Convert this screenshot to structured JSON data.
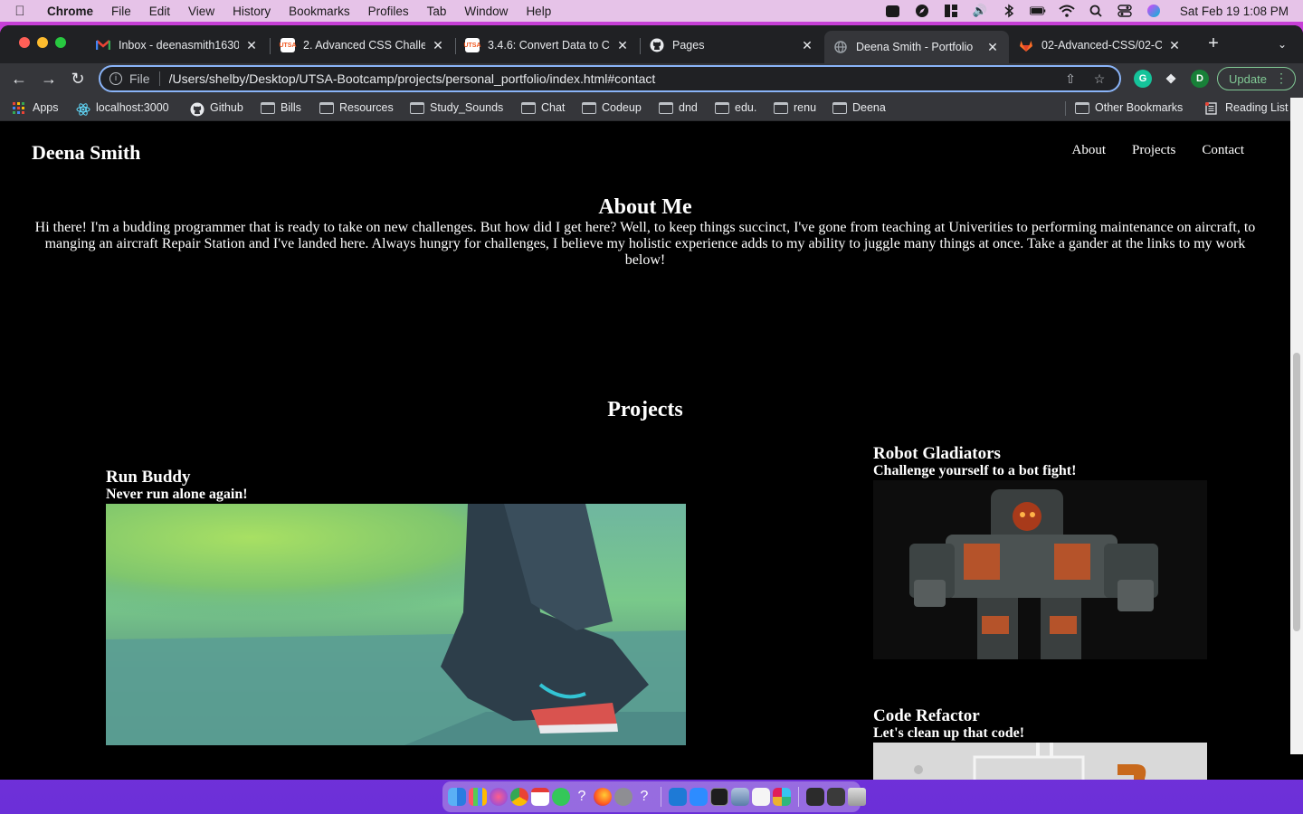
{
  "menubar": {
    "app_name": "Chrome",
    "items": [
      "File",
      "Edit",
      "View",
      "History",
      "Bookmarks",
      "Profiles",
      "Tab",
      "Window",
      "Help"
    ],
    "clock": "Sat Feb 19  1:08 PM"
  },
  "tabs": [
    {
      "title": "Inbox - deenasmith1630",
      "icon": "gmail-icon",
      "active": false
    },
    {
      "title": "2. Advanced CSS Challe",
      "icon": "utsa-icon",
      "active": false
    },
    {
      "title": "3.4.6: Convert Data to C",
      "icon": "utsa-icon",
      "active": false
    },
    {
      "title": "Pages",
      "icon": "github-icon",
      "active": false
    },
    {
      "title": "Deena Smith - Portfolio",
      "icon": "globe-icon",
      "active": true
    },
    {
      "title": "02-Advanced-CSS/02-C",
      "icon": "gitlab-icon",
      "active": false
    }
  ],
  "omnibox": {
    "scheme": "File",
    "url": "/Users/shelby/Desktop/UTSA-Bootcamp/projects/personal_portfolio/index.html#contact"
  },
  "toolbar": {
    "profile_initial": "D",
    "update_label": "Update"
  },
  "bookmarks": {
    "items": [
      {
        "label": "Apps",
        "icon": "apps-grid-icon"
      },
      {
        "label": "localhost:3000",
        "icon": "react-icon"
      },
      {
        "label": "Github",
        "icon": "github-icon"
      },
      {
        "label": "Bills",
        "icon": "folder-icon"
      },
      {
        "label": "Resources",
        "icon": "folder-icon"
      },
      {
        "label": "Study_Sounds",
        "icon": "folder-icon"
      },
      {
        "label": "Chat",
        "icon": "folder-icon"
      },
      {
        "label": "Codeup",
        "icon": "folder-icon"
      },
      {
        "label": "dnd",
        "icon": "folder-icon"
      },
      {
        "label": "edu.",
        "icon": "folder-icon"
      },
      {
        "label": "renu",
        "icon": "folder-icon"
      },
      {
        "label": "Deena",
        "icon": "folder-icon"
      }
    ],
    "other": "Other Bookmarks",
    "reading_list": "Reading List"
  },
  "site": {
    "name": "Deena Smith",
    "nav": [
      "About",
      "Projects",
      "Contact"
    ],
    "about_heading": "About Me",
    "about_text": "Hi there! I'm a budding programmer that is ready to take on new challenges. But how did I get here? Well, to keep things succinct, I've gone from teaching at Univerities to performing maintenance on aircraft, to manging an aircraft Repair Station and I've landed here. Always hungry for challenges, I believe my holistic experience adds to my ability to juggle many things at once. Take a gander at the links to my work below!",
    "projects_heading": "Projects",
    "projects": [
      {
        "title": "Run Buddy",
        "tagline": "Never run alone again!"
      },
      {
        "title": "Robot Gladiators",
        "tagline": "Challenge yourself to a bot fight!"
      },
      {
        "title": "Code Refactor",
        "tagline": "Let's clean up that code!"
      }
    ]
  },
  "colors": {
    "page_bg": "#000000",
    "page_text": "#ffffff",
    "omnibox_focus": "#8ab4f8",
    "update_green": "#81c995"
  }
}
